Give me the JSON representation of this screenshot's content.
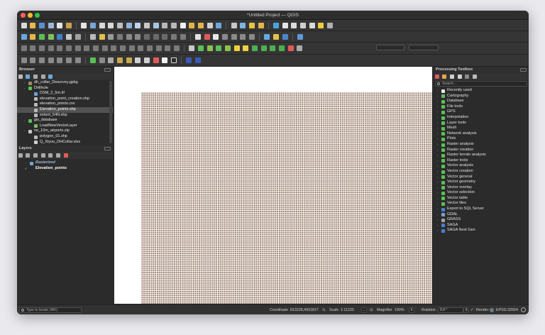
{
  "window": {
    "title": "*Untitled Project — QGIS"
  },
  "browser": {
    "title": "Browser",
    "items": [
      {
        "label": "dh_collar_Desurvey.gpkg",
        "indent": 16,
        "arrow": "›",
        "color": "#e8e8e8",
        "icon": "#9c8b63"
      },
      {
        "label": "Drillhole",
        "indent": 16,
        "arrow": "›",
        "color": "#e8e8e8",
        "icon": "#5bbf56"
      },
      {
        "label": "DSM_2_5m.tif",
        "indent": 24,
        "arrow": "",
        "color": "#e8e8e8",
        "icon": "#6fa3d8"
      },
      {
        "label": "elevation_point_creation.shp",
        "indent": 24,
        "arrow": "",
        "color": "#e8e8e8",
        "icon": "#b9b9b9"
      },
      {
        "label": "elevation_points.csv",
        "indent": 24,
        "arrow": "",
        "color": "#e8e8e8",
        "icon": "#b9b9b9"
      },
      {
        "label": "Elevation_points.shp",
        "indent": 24,
        "arrow": "",
        "color": "#ffffff",
        "icon": "#b9b9b9",
        "selected": true
      },
      {
        "label": "extent_54N.shp",
        "indent": 24,
        "arrow": "",
        "color": "#e8e8e8",
        "icon": "#b9b9b9"
      },
      {
        "label": "gis_database",
        "indent": 16,
        "arrow": "›",
        "color": "#e8e8e8",
        "icon": "#5bbf56"
      },
      {
        "label": "LoadNewVectorLayer",
        "indent": 24,
        "arrow": "",
        "color": "#e8e8e8",
        "icon": "#7bbf66"
      },
      {
        "label": "ne_10m_airports.zip",
        "indent": 16,
        "arrow": "›",
        "color": "#e8e8e8",
        "icon": "#c9c9c9"
      },
      {
        "label": "polygon_01.shp",
        "indent": 24,
        "arrow": "",
        "color": "#e8e8e8",
        "icon": "#b9b9b9"
      },
      {
        "label": "Q_Xiyuo_DHCollar.xlsx",
        "indent": 24,
        "arrow": "",
        "color": "#e8e8e8",
        "icon": "#cfcfcf"
      }
    ]
  },
  "layers": {
    "title": "Layers",
    "items": [
      {
        "label": "Rasterized",
        "italic": true,
        "bold": true,
        "arrow": "›",
        "check": "",
        "color": "#9fb9d8",
        "icon": "#6fa3d8"
      },
      {
        "label": "Elevation_points",
        "italic": false,
        "bold": true,
        "arrow": "",
        "check": "✓",
        "color": "#ffffff",
        "icon": ""
      }
    ]
  },
  "processing": {
    "title": "Processing Toolbox",
    "search_placeholder": "Search…",
    "items": [
      {
        "label": "Recently used",
        "icon": "#e8e8e8"
      },
      {
        "label": "Cartography",
        "icon": "#5bbf56"
      },
      {
        "label": "Database",
        "icon": "#5bbf56"
      },
      {
        "label": "File tools",
        "icon": "#5bbf56"
      },
      {
        "label": "GPS",
        "icon": "#5bbf56"
      },
      {
        "label": "Interpolation",
        "icon": "#5bbf56"
      },
      {
        "label": "Layer tools",
        "icon": "#5bbf56"
      },
      {
        "label": "Mesh",
        "icon": "#5bbf56"
      },
      {
        "label": "Network analysis",
        "icon": "#5bbf56"
      },
      {
        "label": "Plots",
        "icon": "#5bbf56"
      },
      {
        "label": "Raster analysis",
        "icon": "#5bbf56"
      },
      {
        "label": "Raster creation",
        "icon": "#5bbf56"
      },
      {
        "label": "Raster terrain analysis",
        "icon": "#5bbf56"
      },
      {
        "label": "Raster tools",
        "icon": "#5bbf56"
      },
      {
        "label": "Vector analysis",
        "icon": "#5bbf56"
      },
      {
        "label": "Vector creation",
        "icon": "#5bbf56"
      },
      {
        "label": "Vector general",
        "icon": "#5bbf56"
      },
      {
        "label": "Vector geometry",
        "icon": "#5bbf56"
      },
      {
        "label": "Vector overlay",
        "icon": "#5bbf56"
      },
      {
        "label": "Vector selection",
        "icon": "#5bbf56"
      },
      {
        "label": "Vector table",
        "icon": "#5bbf56"
      },
      {
        "label": "Vector tiles",
        "icon": "#5bbf56"
      },
      {
        "label": "Export to SQL Server",
        "icon": "#4c7fd1"
      },
      {
        "label": "GDAL",
        "icon": "#7aa0c8"
      },
      {
        "label": "GRASS",
        "icon": "#a0a0a0"
      },
      {
        "label": "SAGA",
        "icon": "#4c7fd1"
      },
      {
        "label": "SAGA Next Gen",
        "icon": "#4c7fd1"
      }
    ]
  },
  "status": {
    "locate_placeholder": "Type to locate (⌘K)",
    "coordinate_label": "Coordinate",
    "coordinate_value": "813228,4931817",
    "scale_label": "Scale",
    "scale_value": "1:11233",
    "magnifier_label": "Magnifier",
    "magnifier_value": "100%",
    "rotation_label": "Rotation",
    "rotation_value": "0.0 °",
    "render_label": "Render",
    "crs_value": "EPSG:32654"
  },
  "colors": {
    "accent_green": "#5bbf56",
    "point_color": "#8a6a55",
    "panel_bg": "#2b2b2b"
  }
}
